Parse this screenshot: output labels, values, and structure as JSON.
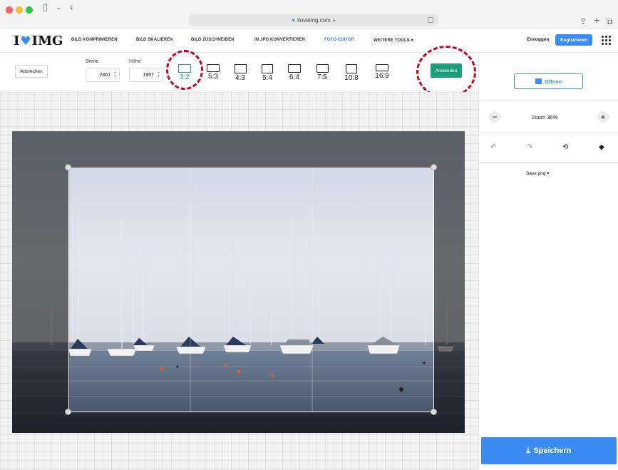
{
  "browser": {
    "url": "iloveimg.com",
    "icons": [
      "sidebar-icon",
      "chevron-down-icon",
      "back-icon",
      "share-icon",
      "new-tab-icon",
      "tabs-icon",
      "lock-icon",
      "reader-icon"
    ]
  },
  "nav": {
    "logo_left": "I",
    "logo_right": "IMG",
    "links": [
      "BILD KOMPRIMIEREN",
      "BILD SKALIEREN",
      "BILD ZUSCHNEIDEN",
      "IN JPG KONVERTIEREN",
      "FOTO-EDITOR",
      "WEITERE TOOLS ▾"
    ],
    "active_link": "FOTO-EDITOR",
    "login": "Einloggen",
    "register": "Registrieren",
    "accent_color": "#3b8cf2"
  },
  "toolbar": {
    "cancel_label": "Abbrechen",
    "width_label": "Breite",
    "width_value": "2861",
    "height_label": "Höhe",
    "height_value": "1907",
    "ratios": [
      "3:2",
      "5:3",
      "4:3",
      "5:4",
      "6:4",
      "7:5",
      "10:8",
      "16:9"
    ],
    "active_ratio": "3:2",
    "apply_label": "Anwenden",
    "apply_color": "#1b9e7b",
    "active_color": "#20a08a"
  },
  "sidebar": {
    "open_label": "Öffnen",
    "zoom_minus": "−",
    "zoom_label": "Zoom 36%",
    "zoom_plus": "+",
    "save_format": "Save png ▾",
    "save_label": "Speichern",
    "history_icons": [
      "undo-icon",
      "redo-icon",
      "reset-icon",
      "layers-icon"
    ]
  },
  "annotation_color": "#d0021b"
}
